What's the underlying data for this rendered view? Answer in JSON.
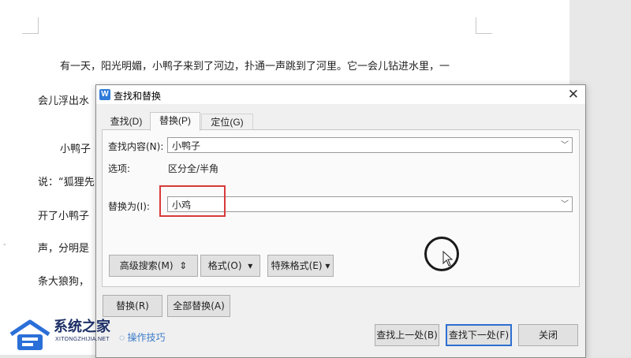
{
  "document": {
    "line1": "有一天，阳光明媚，小鸭子来到了河边，扑通一声跳到了河里。它一会儿钻进水里，一",
    "line2": "会儿浮出水",
    "line3": "小鸭子",
    "line4": "说：“狐狸先",
    "line5": "开了小鸭子",
    "line6": "声，分明是",
    "line7": "条大狼狗，"
  },
  "dialog": {
    "title": "查找和替换",
    "tabs": [
      "查找(D)",
      "替换(P)",
      "定位(G)"
    ],
    "find_label": "查找内容(N):",
    "find_value": "小鸭子",
    "options_label": "选项:",
    "options_value": "区分全/半角",
    "replace_label": "替换为(I):",
    "replace_value": "小鸡",
    "advanced_search": "高级搜索(M)",
    "format": "格式(O)",
    "special_format": "特殊格式(E)",
    "replace_button": "替换(R)",
    "replace_all_button": "全部替换(A)",
    "tips": "操作技巧",
    "find_prev": "查找上一处(B)",
    "find_next": "查找下一处(F)",
    "close": "关闭"
  },
  "watermark": {
    "title": "系统之家",
    "subtitle": "XITONGZHIJIA.NET"
  },
  "colors": {
    "accent": "#2e6fd0",
    "highlight": "#d83a3a",
    "tips_link": "#3c7cc9"
  }
}
